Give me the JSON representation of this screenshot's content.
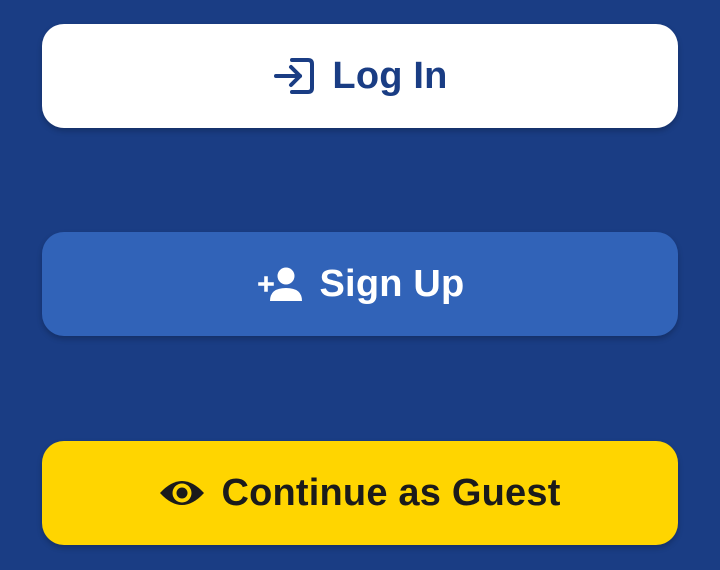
{
  "buttons": {
    "login": {
      "label": "Log In",
      "icon": "login-icon"
    },
    "signup": {
      "label": "Sign Up",
      "icon": "person-add-icon"
    },
    "guest": {
      "label": "Continue as Guest",
      "icon": "eye-icon"
    }
  },
  "colors": {
    "background": "#1a3d84",
    "login_bg": "#ffffff",
    "login_text": "#1a3d84",
    "signup_bg": "#3163b8",
    "signup_text": "#ffffff",
    "guest_bg": "#ffd500",
    "guest_text": "#1b1b1b"
  }
}
